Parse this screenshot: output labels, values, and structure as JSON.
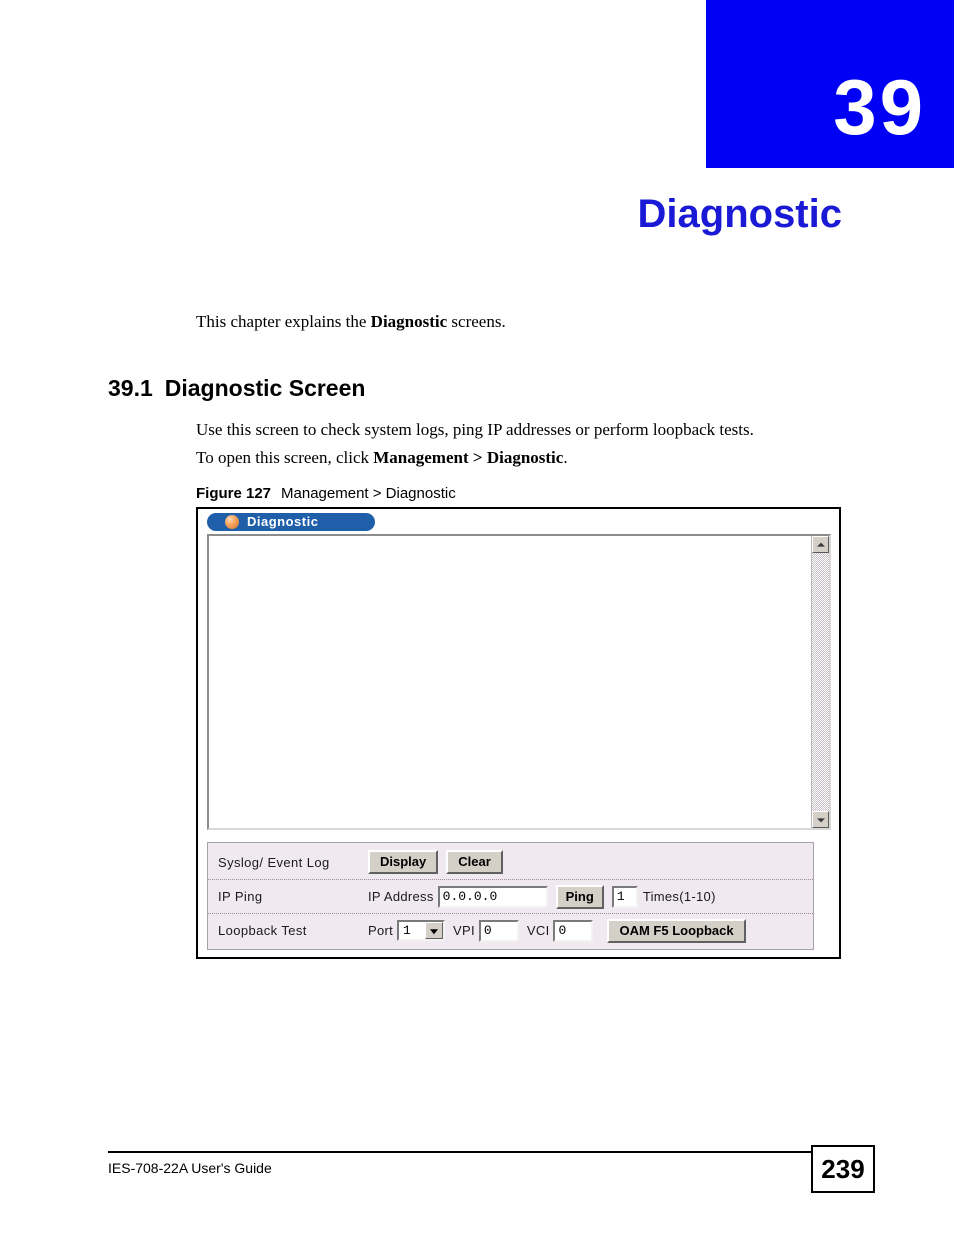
{
  "chapter": {
    "number": "39",
    "title": "Diagnostic",
    "banner_color": "#0000f5",
    "title_color": "#1a1ad6"
  },
  "intro": {
    "before": "This chapter explains the ",
    "bold": "Diagnostic",
    "after": " screens."
  },
  "section": {
    "number": "39.1",
    "heading": "Diagnostic Screen",
    "para1": "Use this screen to check system logs, ping IP addresses or perform loopback tests.",
    "para2_before": "To open this screen, click ",
    "para2_bold": "Management > Diagnostic",
    "para2_after": "."
  },
  "figure": {
    "label": "Figure 127",
    "caption": "Management > Diagnostic"
  },
  "screen": {
    "tab_label": "Diagnostic",
    "tab_icon": "orange-orb-icon",
    "log_text": "",
    "scrollbar": {
      "up_icon": "scroll-up-arrow-icon",
      "down_icon": "scroll-down-arrow-icon"
    },
    "rows": {
      "syslog": {
        "label": "Syslog/ Event Log",
        "display_button": "Display",
        "clear_button": "Clear"
      },
      "ping": {
        "label": "IP  Ping",
        "ip_address_label": "IP Address",
        "ip_address_value": "0.0.0.0",
        "ip_address_placeholder": "0.0.0.0",
        "ping_button": "Ping",
        "times_value": "1",
        "times_label": "Times(1-10)"
      },
      "loopback": {
        "label": "Loopback Test",
        "port_label": "Port",
        "port_value": "1",
        "port_options": [
          "1"
        ],
        "vpi_label": "VPI",
        "vpi_value": "0",
        "vci_label": "VCI",
        "vci_value": "0",
        "loopback_button": "OAM F5 Loopback"
      }
    }
  },
  "footer": {
    "guide": "IES-708-22A User's Guide",
    "page": "239"
  }
}
